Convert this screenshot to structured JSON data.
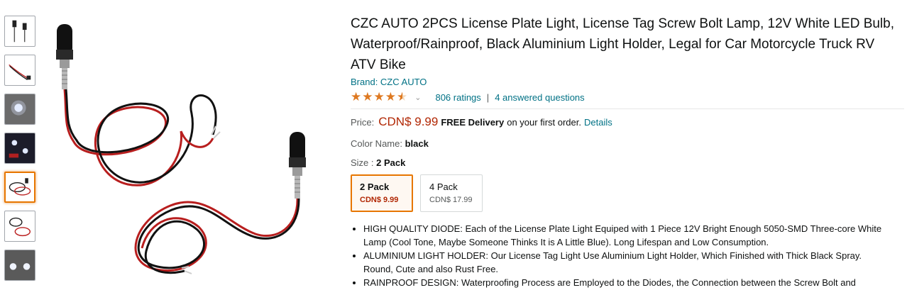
{
  "thumbnails": [
    {
      "name": "thumbnail-1",
      "selected": false
    },
    {
      "name": "thumbnail-2",
      "selected": false
    },
    {
      "name": "thumbnail-3",
      "selected": false
    },
    {
      "name": "thumbnail-4",
      "selected": false
    },
    {
      "name": "thumbnail-5",
      "selected": true
    },
    {
      "name": "thumbnail-6",
      "selected": false
    },
    {
      "name": "thumbnail-7",
      "selected": false
    }
  ],
  "product": {
    "title": "CZC AUTO 2PCS License Plate Light, License Tag Screw Bolt Lamp, 12V White LED Bulb, Waterproof/Rainproof, Black Aluminium Light Holder, Legal for Car Motorcycle Truck RV ATV Bike",
    "brand": "Brand: CZC AUTO",
    "rating_value": 4.5,
    "rating_count": "806 ratings",
    "separator": "|",
    "answered": "4 answered questions",
    "price_label": "Price:",
    "price": "CDN$ 9.99",
    "free_delivery": "FREE Delivery",
    "delivery_text": "on your first order.",
    "details_link": "Details",
    "color_label": "Color Name:",
    "color_value": "black",
    "size_label": "Size :",
    "size_value": "2 Pack",
    "size_options": [
      {
        "name": "2 Pack",
        "price": "CDN$ 9.99",
        "selected": true
      },
      {
        "name": "4 Pack",
        "price": "CDN$ 17.99",
        "selected": false
      }
    ],
    "bullets": [
      "HIGH QUALITY DIODE: Each of the License Plate Light Equiped with 1 Piece 12V Bright Enough 5050-SMD Three-core White Lamp (Cool Tone, Maybe Someone Thinks It is A Little Blue). Long Lifespan and Low Consumption.",
      "ALUMINIUM LIGHT HOLDER: Our License Tag Light Use Aluminium Light Holder, Which Finished with Thick Black Spray. Round, Cute and also Rust Free.",
      "RAINPROOF DESIGN: Waterproofing Process are Employed to the Diodes, the Connection between the Screw Bolt and"
    ]
  },
  "colors": {
    "link": "#007185",
    "price": "#b12704",
    "star": "#de7921",
    "selected_border": "#e77600"
  },
  "icons": {
    "star": "star-icon",
    "caret": "chevron-down-icon"
  }
}
